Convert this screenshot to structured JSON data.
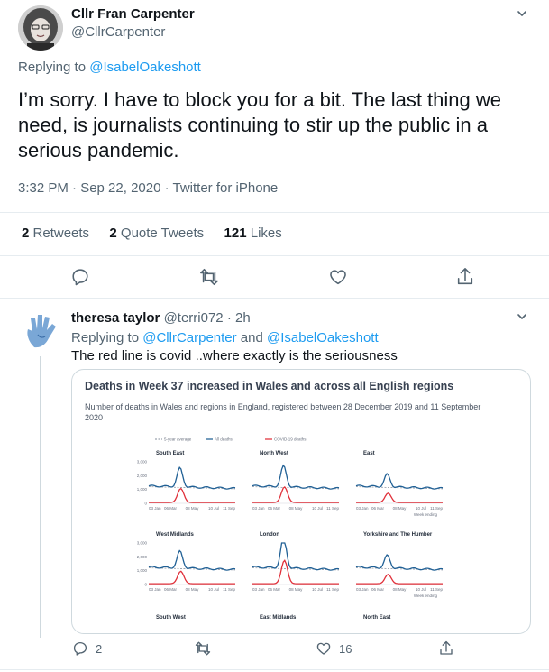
{
  "tweet": {
    "author_name": "Cllr Fran Carpenter",
    "author_handle": "@CllrCarpenter",
    "replying_prefix": "Replying to ",
    "replying_to": "@IsabelOakeshott",
    "text": "I’m sorry. I have to block you for a bit. The last thing we need, is journalists continuing to stir up the public in a serious pandemic.",
    "timestamp": "3:32 PM · Sep 22, 2020 · Twitter for iPhone",
    "stats": {
      "retweets_count": "2",
      "retweets_label": "Retweets",
      "quotes_count": "2",
      "quotes_label": "Quote Tweets",
      "likes_count": "121",
      "likes_label": "Likes"
    }
  },
  "reply": {
    "author_name": "theresa taylor",
    "author_handle_time": "@terri072 · 2h",
    "replying_prefix": "Replying to ",
    "replying_to_1": "@CllrCarpenter",
    "replying_and": " and ",
    "replying_to_2": "@IsabelOakeshott",
    "text": "The red line is covid ..where exactly is the seriousness",
    "reply_count": "2",
    "like_count": "16"
  },
  "chart_image": {
    "title": "Deaths in Week 37 increased in Wales and across all English regions",
    "subtitle": "Number of deaths in Wales and regions in England, registered between 28 December 2019 and 11 September 2020",
    "legend": [
      "5-year average",
      "All deaths",
      "COVID-19 deaths"
    ],
    "colors": {
      "average": "#9ca3af",
      "all": "#206095",
      "covid": "#e0303a"
    },
    "y_ticks": [
      "3,000",
      "2,000",
      "1,000",
      "0"
    ],
    "x_ticks": [
      "03 Jan",
      "06 Mar",
      "08 May",
      "10 Jul",
      "11 Sep"
    ],
    "week_ending": "Week ending",
    "panel_titles_top": [
      "South East",
      "North West",
      "East"
    ],
    "panel_titles_mid": [
      "West Midlands",
      "London",
      "Yorkshire and The Humber"
    ],
    "panel_titles_bottom": [
      "South West",
      "East Midlands",
      "North East"
    ]
  },
  "chart_data": {
    "type": "line",
    "title": "Deaths in Week 37 increased in Wales and across all English regions",
    "x": [
      "03 Jan",
      "06 Mar",
      "08 May",
      "10 Jul",
      "11 Sep"
    ],
    "ylim": [
      0,
      3000
    ],
    "series": [
      {
        "name": "5-year average"
      },
      {
        "name": "All deaths"
      },
      {
        "name": "COVID-19 deaths"
      }
    ]
  }
}
